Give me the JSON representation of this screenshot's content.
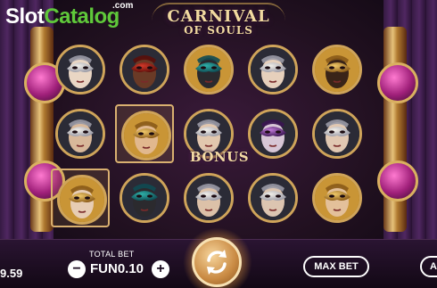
{
  "brand": {
    "slot": "Slot",
    "catalog": "Catalog",
    "com": ".com"
  },
  "game": {
    "title_line1": "CARNIVAL",
    "title_line2": "OF SOULS"
  },
  "reels": {
    "bonus_label": "BONUS",
    "symbols": [
      [
        {
          "mask": "silver",
          "skin": "#e9d6c4",
          "ring": "#2b2b36",
          "hl": false
        },
        {
          "mask": "silver",
          "skin": "#d8b89a",
          "ring": "#2b2b36",
          "hl": false
        },
        {
          "mask": "gold",
          "skin": "#e7cdb4",
          "ring": "#c99536",
          "hl": true
        }
      ],
      [
        {
          "mask": "red",
          "skin": "#6a3a26",
          "ring": "#2b2b36",
          "hl": false
        },
        {
          "mask": "gold",
          "skin": "#e1b88e",
          "ring": "#c99536",
          "hl": true
        },
        {
          "mask": "teal",
          "skin": "#2b2a2e",
          "ring": "#2b2b36",
          "hl": false
        }
      ],
      [
        {
          "mask": "teal",
          "skin": "#2a2a2e",
          "ring": "#c99536",
          "hl": false
        },
        {
          "mask": "silver",
          "skin": "#e2c7ae",
          "ring": "#2b2b36",
          "hl": false
        },
        {
          "mask": "silver",
          "skin": "#dcc1a8",
          "ring": "#2b2b36",
          "hl": false
        }
      ],
      [
        {
          "mask": "silver",
          "skin": "#e6d0bc",
          "ring": "#2b2b36",
          "hl": false
        },
        {
          "mask": "purple",
          "skin": "#d7c6d6",
          "ring": "#2b2b36",
          "hl": false
        },
        {
          "mask": "silver",
          "skin": "#dcc5b1",
          "ring": "#2b2b36",
          "hl": false
        }
      ],
      [
        {
          "mask": "gold",
          "skin": "#3a2418",
          "ring": "#c99536",
          "hl": false
        },
        {
          "mask": "silver",
          "skin": "#e1c8b2",
          "ring": "#2b2b36",
          "hl": false
        },
        {
          "mask": "gold",
          "skin": "#e3c09a",
          "ring": "#c99536",
          "hl": false
        }
      ]
    ]
  },
  "controls": {
    "balance_value": "9.59",
    "total_bet_label": "TOTAL BET",
    "total_bet_value": "FUN0.10",
    "minus": "−",
    "plus": "+",
    "max_bet": "MAX BET",
    "auto": "A"
  },
  "colors": {
    "brand_green": "#5fc83a",
    "gold": "#cfa45a",
    "title": "#f1d9a0"
  }
}
